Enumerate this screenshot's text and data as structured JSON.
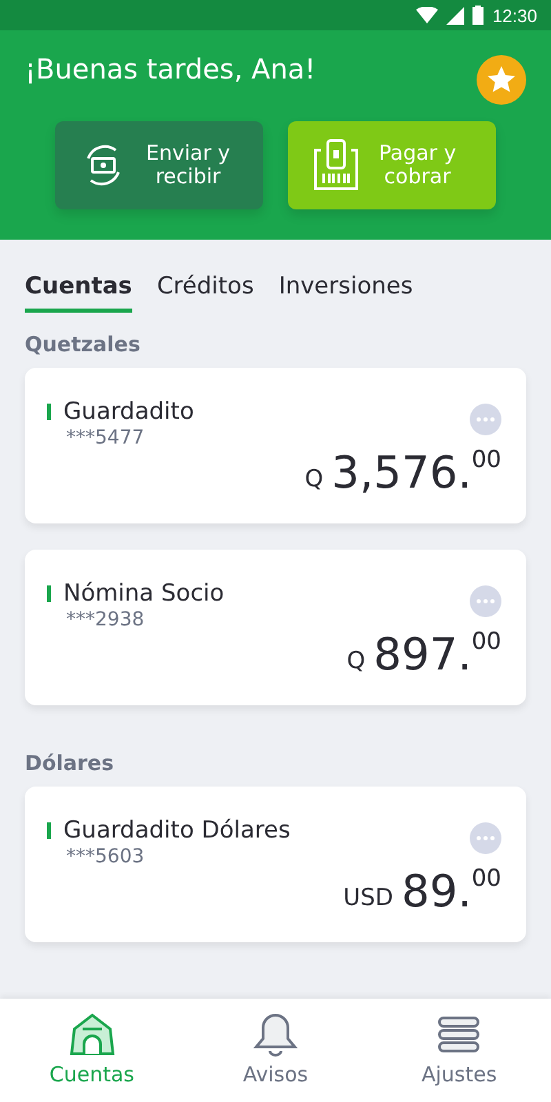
{
  "status_bar": {
    "time": "12:30"
  },
  "header": {
    "greeting": "¡Buenas tardes, Ana!",
    "actions": [
      {
        "kind": "transfer",
        "label": "Enviar y\nrecibir"
      },
      {
        "kind": "pay",
        "label": "Pagar y\ncobrar"
      }
    ]
  },
  "tabs": [
    {
      "label": "Cuentas",
      "selected": true
    },
    {
      "label": "Créditos",
      "selected": false
    },
    {
      "label": "Inversiones",
      "selected": false
    }
  ],
  "sections": [
    {
      "title": "Quetzales",
      "accounts": [
        {
          "name": "Guardadito",
          "number": "***5477",
          "currency": "Q",
          "amount": "3,576.",
          "cents": "00"
        },
        {
          "name": "Nómina Socio",
          "number": "***2938",
          "currency": "Q",
          "amount": "897.",
          "cents": "00"
        }
      ]
    },
    {
      "title": "Dólares",
      "accounts": [
        {
          "name": "Guardadito Dólares",
          "number": "***5603",
          "currency": "USD",
          "amount": "89.",
          "cents": "00"
        }
      ]
    }
  ],
  "bottom_nav": [
    {
      "kind": "home",
      "label": "Cuentas",
      "selected": true
    },
    {
      "kind": "bell",
      "label": "Avisos",
      "selected": false
    },
    {
      "kind": "menu",
      "label": "Ajustes",
      "selected": false
    }
  ]
}
